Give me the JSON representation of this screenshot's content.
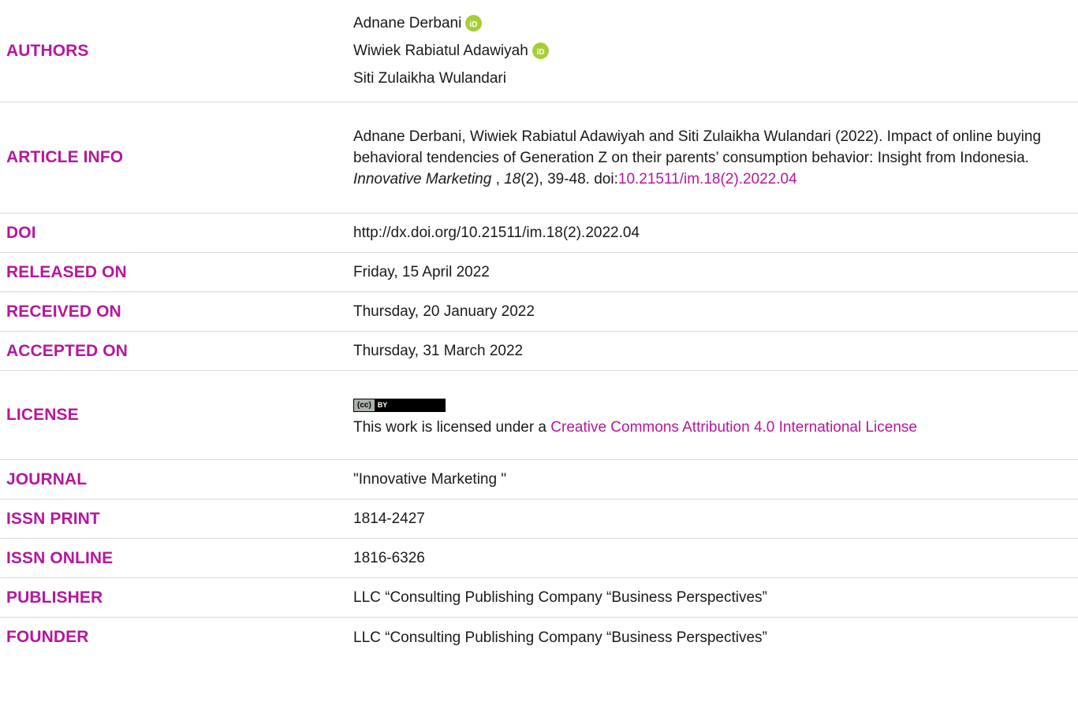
{
  "labels": {
    "authors": "AUTHORS",
    "article_info": "ARTICLE INFO",
    "doi": "DOI",
    "released_on": "RELEASED ON",
    "received_on": "RECEIVED ON",
    "accepted_on": "ACCEPTED ON",
    "license": "LICENSE",
    "journal": "JOURNAL",
    "issn_print": "ISSN PRINT",
    "issn_online": "ISSN ONLINE",
    "publisher": "PUBLISHER",
    "founder": "FOUNDER"
  },
  "authors": [
    {
      "name": "Adnane Derbani",
      "orcid": true
    },
    {
      "name": "Wiwiek Rabiatul Adawiyah",
      "orcid": true
    },
    {
      "name": "Siti Zulaikha Wulandari",
      "orcid": false
    }
  ],
  "article_info": {
    "citation_start": "Adnane Derbani, Wiwiek Rabiatul Adawiyah and Siti Zulaikha Wulandari (2022). Impact of online buying behavioral tendencies of Generation Z on their parents’ consumption behavior: Insight from Indonesia. ",
    "journal_name": "Innovative Marketing",
    "sep": " , ",
    "volume": "18",
    "issue_pages": "(2), 39-48. doi:",
    "doi_link": "10.21511/im.18(2).2022.04"
  },
  "doi": "http://dx.doi.org/10.21511/im.18(2).2022.04",
  "released_on": "Friday, 15 April 2022",
  "received_on": "Thursday, 20 January 2022",
  "accepted_on": "Thursday, 31 March 2022",
  "license": {
    "badge_left": "(cc)",
    "badge_right": "BY",
    "text": "This work is licensed under a ",
    "link_text": "Creative Commons Attribution 4.0 International License"
  },
  "journal": "\"Innovative Marketing \"",
  "issn_print": "1814-2427",
  "issn_online": "1816-6326",
  "publisher": "LLC “Consulting Publishing Company “Business Perspectives”",
  "founder": "LLC “Consulting Publishing Company “Business Perspectives”",
  "colors": {
    "label": "#b5179e",
    "link": "#b5179e",
    "orcid": "#a6ce39"
  }
}
